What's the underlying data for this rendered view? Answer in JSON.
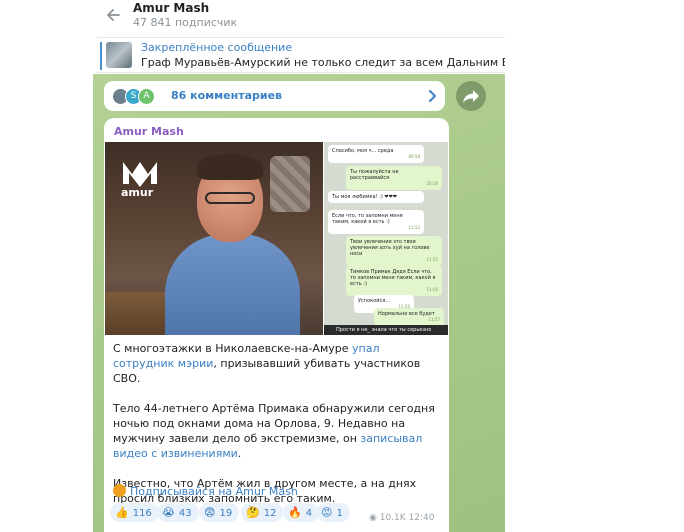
{
  "header": {
    "title": "Amur Mash",
    "subscribers": "47 841 подписчик"
  },
  "pinned": {
    "label": "Закреплённое сообщение",
    "text": "Граф Муравьёв-Амурский не только следит за всем Дальним Востоком о"
  },
  "comments": {
    "avatars": [
      "",
      "S",
      "A"
    ],
    "label": "86 комментариев"
  },
  "message": {
    "author": "Amur Mash",
    "logo_text": "amur",
    "chat_screenshot": {
      "messages": [
        {
          "dir": "in",
          "text": "Спасибо, моя ч... среда",
          "time": "09:58"
        },
        {
          "dir": "out",
          "text": "Ты пожалуйста не расстраивайся",
          "time": "20:28"
        },
        {
          "dir": "in",
          "text": "Ты моя любимка! :) ❤❤❤",
          "time": ""
        },
        {
          "dir": "in",
          "text": "Если что, то запомни меня таким, какой я есть :)",
          "time": "11:52"
        },
        {
          "dir": "out",
          "text": "Твои увлечения это твои увлечения хоть хуй на голове носи",
          "time": "11:55"
        },
        {
          "dir": "out",
          "text": "Тимков Примак Дядя Если что, то запомни меня таким, какой я есть :)",
          "time": "11:56"
        },
        {
          "dir": "in",
          "text": "Успокойся...",
          "time": "11:56"
        },
        {
          "dir": "out",
          "text": "Нормально все будет",
          "time": "11:57"
        }
      ],
      "footer": "Прости я не_ знала что ты серьезно"
    },
    "paragraphs": [
      {
        "before": "С многоэтажки в Николаевске-на-Амуре ",
        "link": "упал сотрудник мэрии",
        "after": ", призывавший убивать участников СВО."
      },
      {
        "before": "Тело 44-летнего Артёма Примака обнаружили сегодня ночью под окнами дома на Орлова, 9. Недавно на мужчину завели дело об экстремизме, он ",
        "link": "записывал видео с извинениями",
        "after": "."
      },
      {
        "before": "Известно, что Артём жил в другом месте, а на днях просил близких запомнить его таким.",
        "link": "",
        "after": ""
      }
    ],
    "subscribe_link": "Подписывайся на Amur Mash",
    "reactions": [
      {
        "emoji": "👍",
        "count": "116"
      },
      {
        "emoji": "😭",
        "count": "43"
      },
      {
        "emoji": "😨",
        "count": "19"
      },
      {
        "emoji": "🤔",
        "count": "12"
      },
      {
        "emoji": "🔥",
        "count": "4"
      },
      {
        "emoji": "😡",
        "count": "1"
      }
    ],
    "views": "10.1K",
    "time": "12:40"
  },
  "colors": {
    "accent": "#3a80c4",
    "author": "#8b5fc2",
    "chat_bg": "#a9c98b",
    "reaction_bg": "#e9f1fa"
  }
}
